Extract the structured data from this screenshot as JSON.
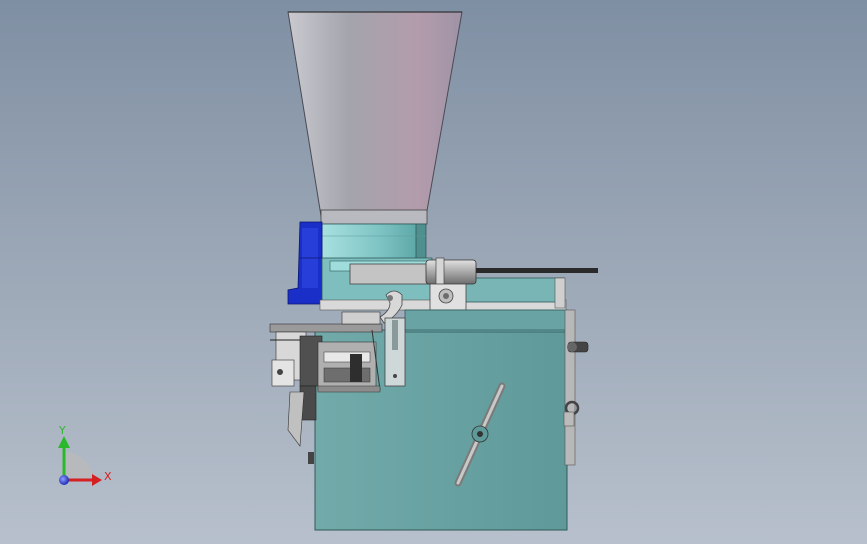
{
  "viewport": {
    "background_top": "#7f8fa3",
    "background_bottom": "#b7c0cc"
  },
  "model": {
    "hopper_color": "#a9aab4",
    "body_color": "#6aa3a3",
    "collar_color": "#8fcfcf",
    "motor_color": "#1a2fc7",
    "feeder_color": "#b0b0b0",
    "shaft_color": "#2a2a2a"
  },
  "triad": {
    "y_label": "Y",
    "x_label": "X",
    "y_color": "#2cb82c",
    "x_color": "#d42020",
    "z_color": "#2030d0"
  }
}
